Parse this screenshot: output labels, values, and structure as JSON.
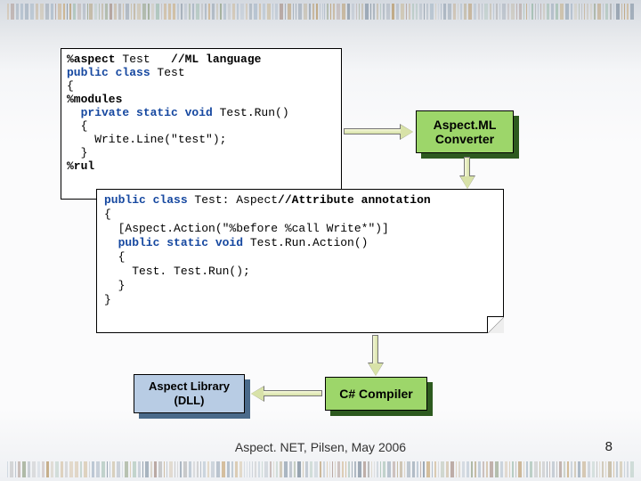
{
  "code1": {
    "l1a": "%aspect",
    "l1b": " Test   ",
    "l1c": "//ML language",
    "l2a": "public class",
    "l2b": " Test",
    "l3": "{",
    "l4": "%modules",
    "l5a": "  private static void",
    "l5b": " Test.Run()",
    "l6": "  {",
    "l7": "    Write.Line(\"test\");",
    "l8": "  }",
    "l9": "%rul"
  },
  "boxes": {
    "converter": "Aspect.ML\nConverter",
    "compiler": "C# Compiler",
    "library": "Aspect Library\n(DLL)"
  },
  "code2": {
    "l1a": "public class",
    "l1b": " Test: Aspect",
    "l1c": "//Attribute annotation",
    "l2": "{",
    "l3": "  [Aspect.Action(\"%before %call Write*\")]",
    "l4a": "  public static void",
    "l4b": " Test.Run.Action()",
    "l5": "  {",
    "l6": "    Test. Test.Run();",
    "l7": "  }",
    "l8": "}"
  },
  "footer": "Aspect. NET, Pilsen, May 2006",
  "page": "8"
}
